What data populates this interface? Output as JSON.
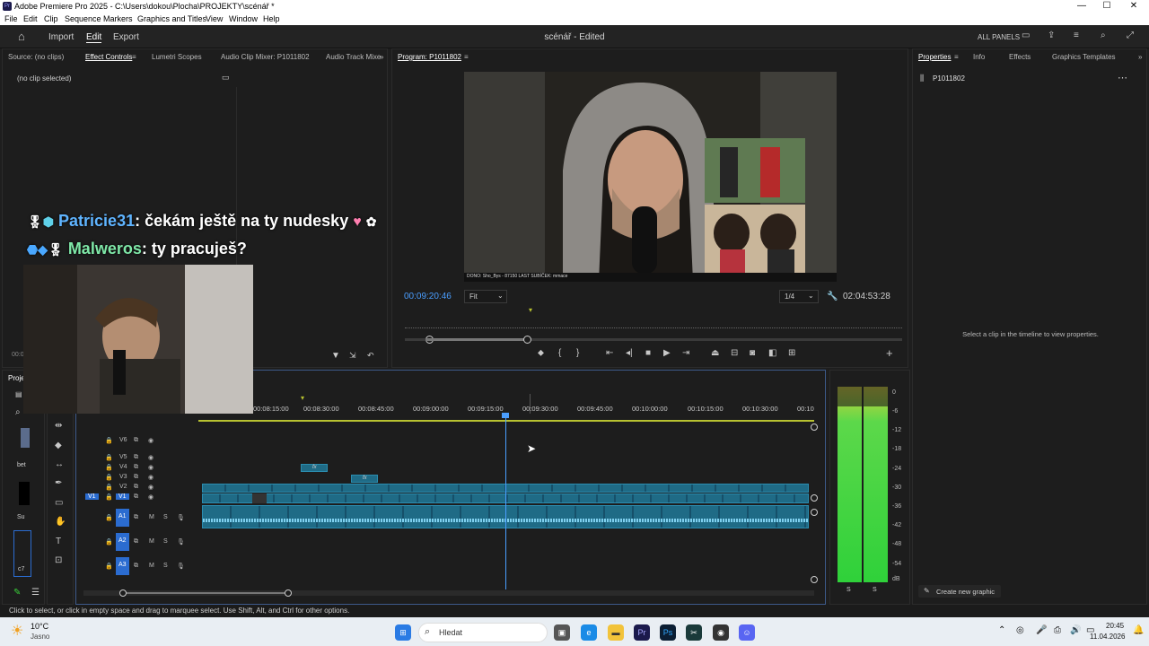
{
  "window": {
    "title": "Adobe Premiere Pro 2025 - C:\\Users\\dokou\\Plocha\\PROJEKTY\\scénář *",
    "min": "—",
    "max": "☐",
    "close": "✕"
  },
  "menu": [
    "File",
    "Edit",
    "Clip",
    "Sequence",
    "Markers",
    "Graphics and Titles",
    "View",
    "Window",
    "Help"
  ],
  "appbar": {
    "tabs": [
      "Import",
      "Edit",
      "Export"
    ],
    "active_tab": "Edit",
    "project_title": "scénář - Edited",
    "all_panels": "ALL PANELS"
  },
  "source_panel": {
    "tabs": [
      "Source: (no clips)",
      "Effect Controls",
      "Lumetri Scopes",
      "Audio Clip Mixer: P1011802",
      "Audio Track Mixe"
    ],
    "no_clip": "(no clip selected)",
    "timecode_partial": "00:0"
  },
  "chat_overlay": {
    "line1_user": "Patricie31",
    "line1_msg": ": čekám ještě na ty nudesky",
    "line2_user": "Malweros",
    "line2_msg": ": ty pracuješ?"
  },
  "program_panel": {
    "title": "Program: P1011802",
    "timecode": "00:09:20:46",
    "fit": "Fit",
    "quality": "1/4",
    "duration": "02:04:53:28",
    "video_caption": "DONO: Sho_Bys - 87150   LAST SUBÍČEK: mmace"
  },
  "properties_panel": {
    "tabs": [
      "Properties",
      "Info",
      "Effects",
      "Graphics Templates"
    ],
    "clip_name": "P1011802",
    "hint": "Select a clip in the timeline to view properties.",
    "create_graphic": "Create new graphic"
  },
  "project_panel": {
    "tab": "Proje",
    "items": [
      "bet",
      "Su",
      "c7"
    ]
  },
  "timeline": {
    "ruler": [
      "00:08:15:00",
      "00:08:30:00",
      "00:08:45:00",
      "00:09:00:00",
      "00:09:15:00",
      "00:09:30:00",
      "00:09:45:00",
      "00:10:00:00",
      "00:10:15:00",
      "00:10:30:00",
      "00:10"
    ],
    "video_tracks": [
      "V6",
      "V5",
      "V4",
      "V3",
      "V2",
      "V1"
    ],
    "audio_tracks": [
      "A1",
      "A2",
      "A3"
    ],
    "source_patch": "V1",
    "fx": "fx",
    "m": "M",
    "s": "S"
  },
  "meter": {
    "scale": [
      "0",
      "-6",
      "-12",
      "-18",
      "-24",
      "-30",
      "-36",
      "-42",
      "-48",
      "-54",
      "dB"
    ],
    "solo": [
      "S",
      "S"
    ]
  },
  "status": "Click to select, or click in empty space and drag to marquee select. Use Shift, Alt, and Ctrl for other options.",
  "taskbar": {
    "temp": "10°C",
    "weather": "Jasno",
    "search": "Hledat",
    "time": "20:45",
    "date": "11.04.2026"
  }
}
